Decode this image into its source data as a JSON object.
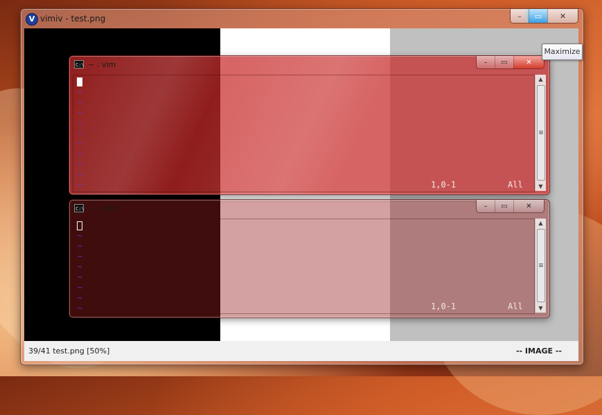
{
  "main_window": {
    "title": "vimiv - test.png",
    "app_icon_glyph": "V",
    "buttons": {
      "minimize": "–",
      "maximize": "▭",
      "close": "✕"
    },
    "status_left": "39/41  test.png  [50%]",
    "status_right": "-- IMAGE --"
  },
  "tooltip": {
    "text": "Maximize"
  },
  "vim_windows": [
    {
      "title": "~ : vim",
      "cmd_icon": "C:\\",
      "buttons": {
        "minimize": "–",
        "maximize": "▭",
        "close": "✕"
      },
      "tildes": [
        "~",
        "~",
        "~",
        "~",
        "~",
        "~",
        "~",
        "~",
        "~",
        "~"
      ],
      "position_text": "1,0-1",
      "scroll_text": "All"
    },
    {
      "title": "~ : vim",
      "cmd_icon": "C:\\",
      "buttons": {
        "minimize": "–",
        "maximize": "▭",
        "close": "✕"
      },
      "tildes": [
        "~",
        "~",
        "~",
        "~",
        "~",
        "~",
        "~",
        "~"
      ],
      "position_text": "1,0-1",
      "scroll_text": "All"
    }
  ],
  "colors": {
    "image_bands": [
      "#000000",
      "#ffffff",
      "#c0c0c0"
    ],
    "vim_active_tint": "#c81e1e",
    "vim_inactive_tint": "#f0b4b4",
    "tilde": "#5a3fd6",
    "maximize_highlight": "#3aa0e6"
  },
  "icons": [
    "app-icon",
    "minimize-icon",
    "maximize-icon",
    "close-icon",
    "cmd-icon",
    "scroll-up-icon",
    "scroll-down-icon"
  ]
}
